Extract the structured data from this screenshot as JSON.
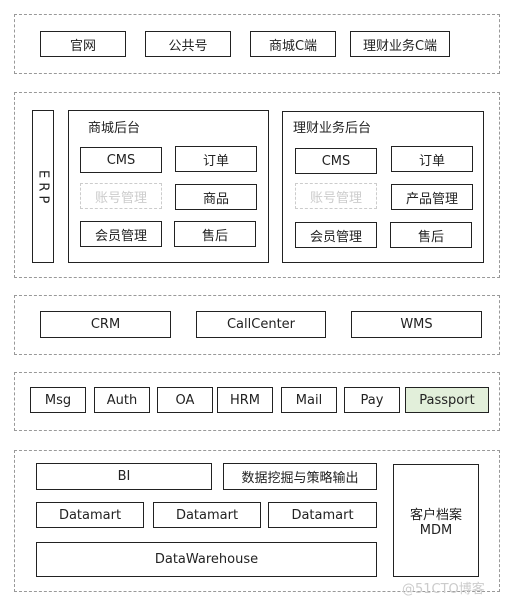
{
  "layer1": {
    "items": [
      "官网",
      "公共号",
      "商城C端",
      "理财业务C端"
    ]
  },
  "layer2": {
    "erp": "E R P",
    "mall": {
      "title": "商城后台",
      "items": [
        "CMS",
        "订单",
        "账号管理",
        "商品",
        "会员管理",
        "售后"
      ]
    },
    "finance": {
      "title": "理财业务后台",
      "items": [
        "CMS",
        "订单",
        "账号管理",
        "产品管理",
        "会员管理",
        "售后"
      ]
    }
  },
  "layer3": {
    "items": [
      "CRM",
      "CallCenter",
      "WMS"
    ]
  },
  "layer4": {
    "items": [
      "Msg",
      "Auth",
      "OA",
      "HRM",
      "Mail",
      "Pay",
      "Passport"
    ],
    "highlight_color": "#e2efda"
  },
  "layer5": {
    "bi": "BI",
    "mining": "数据挖掘与策略输出",
    "datamarts": [
      "Datamart",
      "Datamart",
      "Datamart"
    ],
    "warehouse": "DataWarehouse",
    "mdm_line1": "客户档案",
    "mdm_line2": "MDM"
  },
  "watermark": "@51CTO博客"
}
